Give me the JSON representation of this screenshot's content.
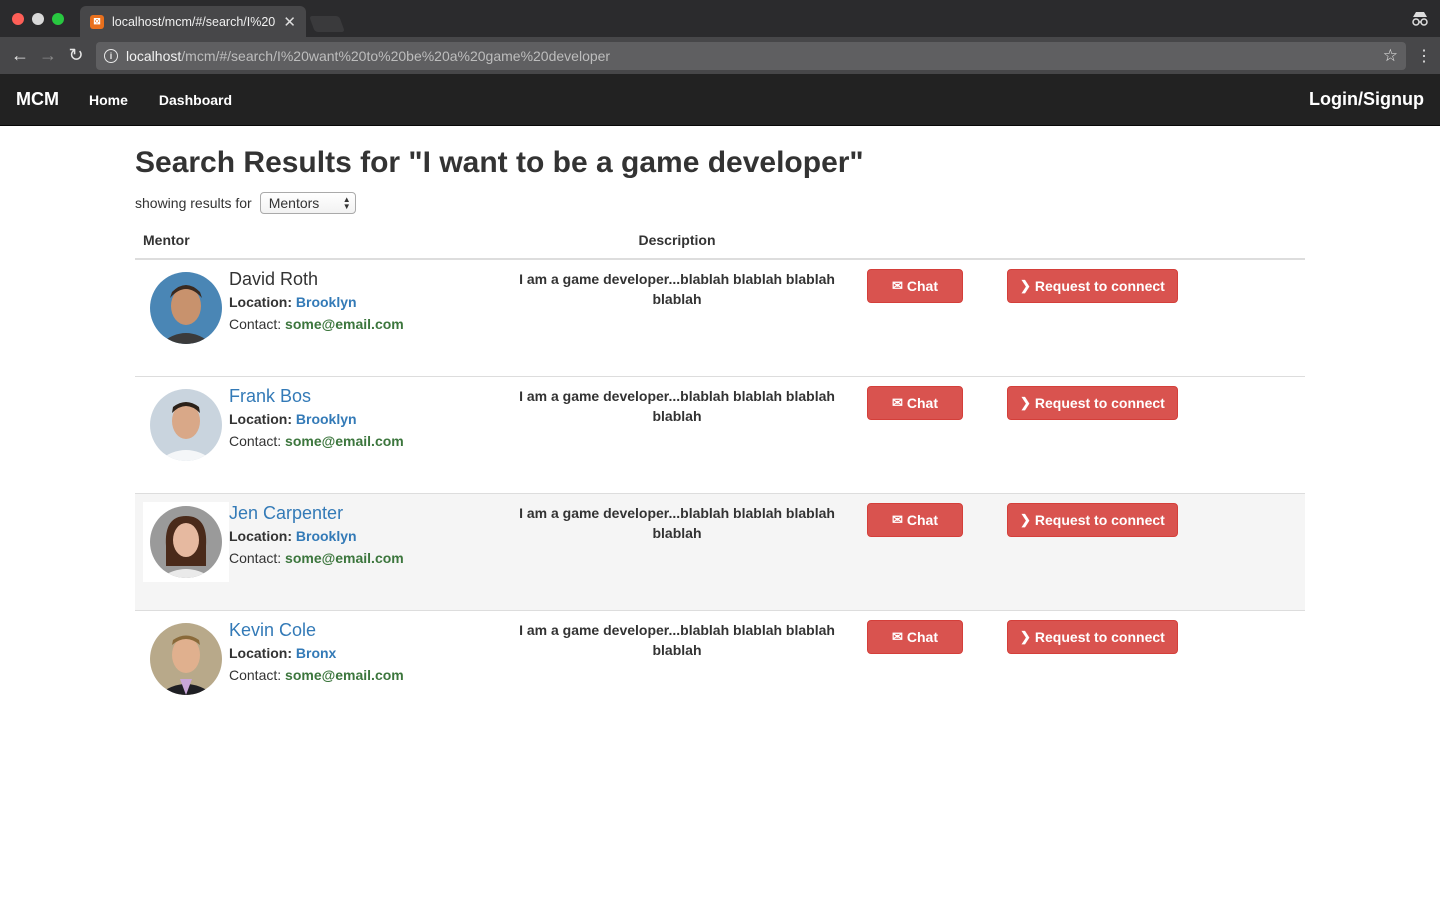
{
  "browser": {
    "tab_title": "localhost/mcm/#/search/I%20",
    "url_host": "localhost",
    "url_path": "/mcm/#/search/I%20want%20to%20be%20a%20game%20developer"
  },
  "nav": {
    "brand": "MCM",
    "links": [
      "Home",
      "Dashboard"
    ],
    "login": "Login/Signup"
  },
  "page": {
    "heading": "Search Results for \"I want to be a game developer\"",
    "filter_label": "showing results for",
    "filter_value": "Mentors"
  },
  "table": {
    "headers": {
      "mentor": "Mentor",
      "description": "Description"
    },
    "rows": [
      {
        "name": "David Roth",
        "location_label": "Location:",
        "location": "Brooklyn",
        "contact_label": "Contact:",
        "email": "some@email.com",
        "description": "I am a game developer...blablah blablah blablah blablah",
        "chat": "Chat",
        "connect": "Request to connect"
      },
      {
        "name": "Frank Bos",
        "location_label": "Location:",
        "location": "Brooklyn",
        "contact_label": "Contact:",
        "email": "some@email.com",
        "description": "I am a game developer...blablah blablah blablah blablah",
        "chat": "Chat",
        "connect": "Request to connect"
      },
      {
        "name": "Jen Carpenter",
        "location_label": "Location:",
        "location": "Brooklyn",
        "contact_label": "Contact:",
        "email": "some@email.com",
        "description": "I am a game developer...blablah blablah blablah blablah",
        "chat": "Chat",
        "connect": "Request to connect"
      },
      {
        "name": "Kevin Cole",
        "location_label": "Location:",
        "location": "Bronx",
        "contact_label": "Contact:",
        "email": "some@email.com",
        "description": "I am a game developer...blablah blablah blablah blablah",
        "chat": "Chat",
        "connect": "Request to connect"
      }
    ]
  },
  "colors": {
    "accent_button": "#d9534f",
    "link": "#337ab7",
    "email": "#3c763d",
    "navbar": "#222222"
  }
}
